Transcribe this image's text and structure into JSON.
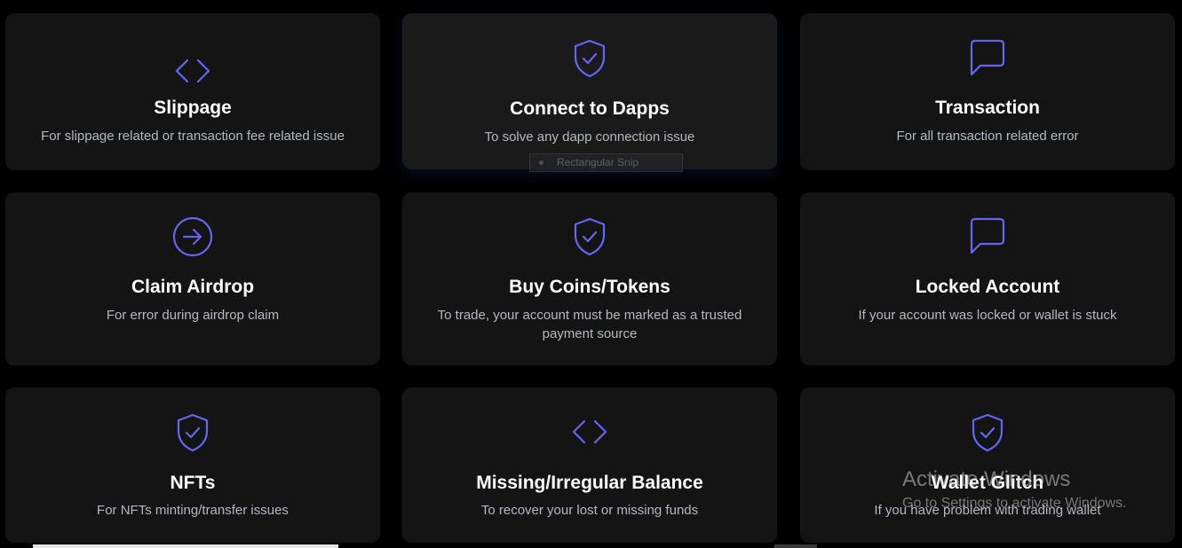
{
  "cards": [
    {
      "icon": "code-icon",
      "title": "Slippage",
      "desc": "For slippage related or transaction fee related issue"
    },
    {
      "icon": "shield-check-icon",
      "title": "Connect to Dapps",
      "desc": "To solve any dapp connection issue"
    },
    {
      "icon": "chat-bubble-icon",
      "title": "Transaction",
      "desc": "For all transaction related error"
    },
    {
      "icon": "arrow-circle-right-icon",
      "title": "Claim Airdrop",
      "desc": "For error during airdrop claim"
    },
    {
      "icon": "shield-check-icon",
      "title": "Buy Coins/Tokens",
      "desc": "To trade, your account must be marked as a trusted payment source"
    },
    {
      "icon": "chat-bubble-icon",
      "title": "Locked Account",
      "desc": "If your account was locked or wallet is stuck"
    },
    {
      "icon": "shield-check-icon",
      "title": "NFTs",
      "desc": "For NFTs minting/transfer issues"
    },
    {
      "icon": "code-icon",
      "title": "Missing/Irregular Balance",
      "desc": "To recover your lost or missing funds"
    },
    {
      "icon": "shield-check-icon",
      "title": "Wallet Glitch",
      "desc": "If you have problem with trading wallet"
    }
  ],
  "tooltip": {
    "label": "Rectangular Snip"
  },
  "watermark": {
    "line1": "Activate Windows",
    "line2": "Go to Settings to activate Windows."
  },
  "colors": {
    "accent": "#6366f1",
    "card_bg": "#141414",
    "page_bg": "#000000"
  }
}
